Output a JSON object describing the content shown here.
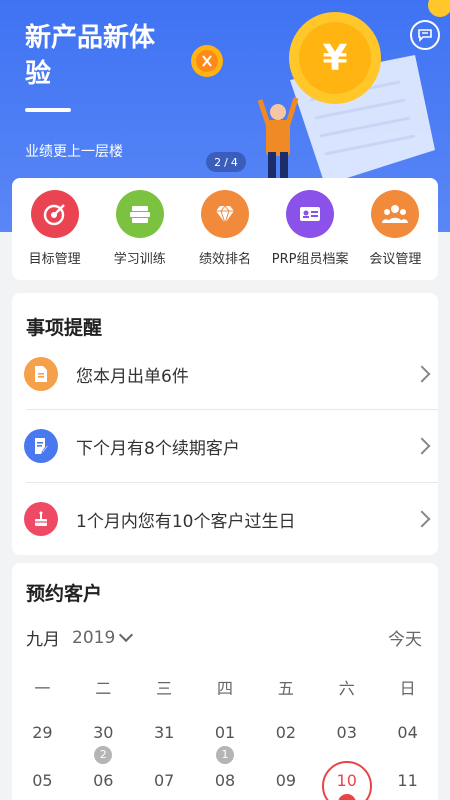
{
  "banner": {
    "title": "新产品新体验",
    "subtitle": "业绩更上一层楼",
    "pager_current": "2",
    "pager_sep": "/",
    "pager_total": "4",
    "coin_symbol": "¥"
  },
  "shortcuts": [
    {
      "label": "目标管理",
      "icon": "target-icon",
      "color": "#ea4452"
    },
    {
      "label": "学习训练",
      "icon": "books-icon",
      "color": "#7cc241"
    },
    {
      "label": "绩效排名",
      "icon": "diamond-icon",
      "color": "#f28a3c"
    },
    {
      "label": "PRP组员档案",
      "icon": "id-card-icon",
      "color": "#8a52e8"
    },
    {
      "label": "会议管理",
      "icon": "people-icon",
      "color": "#f28a3c"
    }
  ],
  "reminders": {
    "title": "事项提醒",
    "items": [
      {
        "text": "您本月出单6件",
        "icon": "document-icon",
        "color": "#f5a04a"
      },
      {
        "text": "下个月有8个续期客户",
        "icon": "edit-doc-icon",
        "color": "#4a78ee"
      },
      {
        "text": "1个月内您有10个客户过生日",
        "icon": "cake-icon",
        "color": "#ee4a66"
      }
    ]
  },
  "calendar": {
    "title": "预约客户",
    "month": "九月",
    "year": "2019",
    "today_label": "今天",
    "weekdays": [
      "一",
      "二",
      "三",
      "四",
      "五",
      "六",
      "日"
    ],
    "week1": [
      {
        "day": "29",
        "badge": ""
      },
      {
        "day": "30",
        "badge": "2"
      },
      {
        "day": "31",
        "badge": ""
      },
      {
        "day": "01",
        "badge": "1"
      },
      {
        "day": "02",
        "badge": ""
      },
      {
        "day": "03",
        "badge": ""
      },
      {
        "day": "04",
        "badge": ""
      }
    ],
    "week2": [
      {
        "day": "05",
        "badge": ""
      },
      {
        "day": "06",
        "badge": ""
      },
      {
        "day": "07",
        "badge": ""
      },
      {
        "day": "08",
        "badge": ""
      },
      {
        "day": "09",
        "badge": ""
      },
      {
        "day": "10",
        "badge": "",
        "selected": true
      },
      {
        "day": "11",
        "badge": ""
      }
    ]
  },
  "colors": {
    "primary": "#3f73f3",
    "alert": "#e84545"
  }
}
